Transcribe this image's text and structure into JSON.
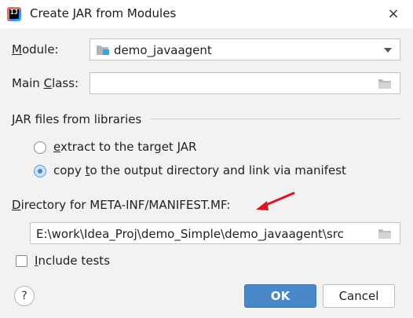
{
  "window": {
    "title": "Create JAR from Modules",
    "app_icon_text": "IJ",
    "close_glyph": "×"
  },
  "module": {
    "label_prefix": "",
    "label_mnemonic": "M",
    "label_rest": "odule:",
    "value": "demo_javaagent",
    "icon": "module-folder-icon"
  },
  "main_class": {
    "label_prefix": "Main ",
    "label_mnemonic": "C",
    "label_rest": "lass:",
    "value": "",
    "icon": "browse-folder-icon"
  },
  "jar_files": {
    "section_label": "JAR files from libraries",
    "options": [
      {
        "prefix": "",
        "mnemonic": "e",
        "rest": "xtract to the target JAR",
        "selected": false
      },
      {
        "prefix": "copy ",
        "mnemonic": "t",
        "rest": "o the output directory and link via manifest",
        "selected": true
      }
    ]
  },
  "manifest_dir": {
    "label_prefix": "",
    "label_mnemonic": "D",
    "label_rest": "irectory for META-INF/MANIFEST.MF:",
    "value": "E:\\work\\Idea_Proj\\demo_Simple\\demo_javaagent\\src",
    "icon": "browse-folder-icon"
  },
  "include_tests": {
    "label_prefix": "",
    "label_mnemonic": "I",
    "label_rest": "nclude tests",
    "checked": false
  },
  "buttons": {
    "help": "?",
    "ok": "OK",
    "cancel": "Cancel"
  },
  "colors": {
    "accent": "#4a87c7",
    "annotation_arrow": "#e0141e"
  }
}
